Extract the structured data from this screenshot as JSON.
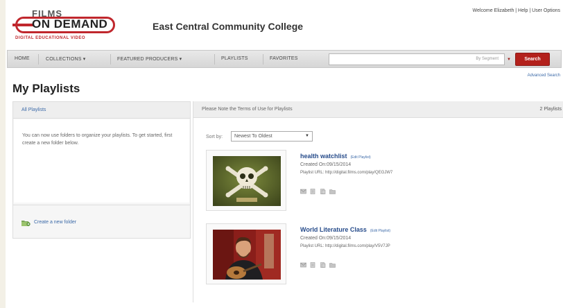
{
  "header": {
    "logo": {
      "top": "FILMS",
      "main": "ON DEMAND",
      "tagline": "DIGITAL EDUCATIONAL VIDEO"
    },
    "college": "East Central Community College",
    "welcome": "Welcome Elizabeth | Help | User Options"
  },
  "nav": {
    "items": [
      "HOME",
      "COLLECTIONS ▾",
      "FEATURED PRODUCERS ▾",
      "PLAYLISTS",
      "FAVORITES"
    ],
    "search_placeholder": "By Segment",
    "search_dropdown": "▼",
    "search_button": "Search",
    "advanced_search": "Advanced Search"
  },
  "page": {
    "title": "My Playlists"
  },
  "left": {
    "header": "All Playlists",
    "info": "You can now use folders to organize your playlists. To get started, first create a new folder below.",
    "create_folder": "Create a new folder"
  },
  "right": {
    "terms": "Please Note the Terms of Use for Playlists",
    "count": "2 Playlists",
    "sort_label": "Sort by:",
    "sort_value": "Newest To Oldest",
    "playlists": [
      {
        "title": "health watchlist",
        "edit": "(Edit Playlist)",
        "created": "Created On:09/15/2014",
        "url": "Playlist URL: http://digital.films.com/play/QEGJW7"
      },
      {
        "title": "World Literature Class",
        "edit": "(Edit Playlist)",
        "created": "Created On:09/15/2014",
        "url": "Playlist URL: http://digital.films.com/play/V5V7JP"
      }
    ]
  },
  "colors": {
    "brand_red": "#c0272d",
    "link_blue": "#3c6aa8",
    "title_blue": "#264b8a",
    "search_red": "#b3211c"
  }
}
